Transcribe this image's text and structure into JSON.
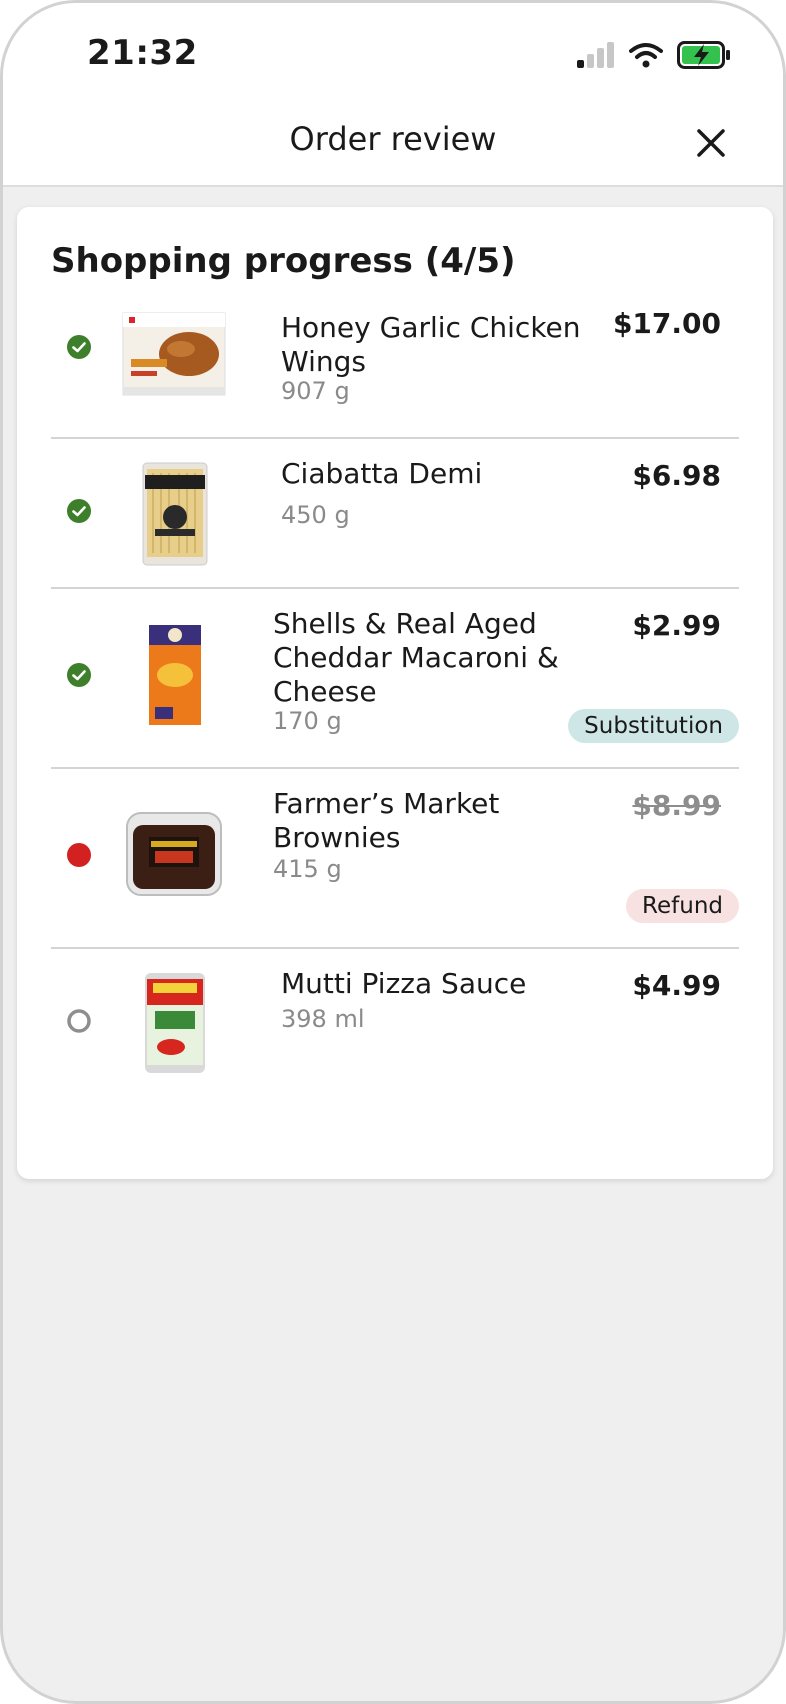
{
  "status_bar": {
    "time": "21:32"
  },
  "header": {
    "title": "Order review"
  },
  "progress": {
    "title": "Shopping progress (4/5)",
    "items": [
      {
        "name_lines": [
          "Honey Garlic Chicken",
          "Wings"
        ],
        "qty": "907 g",
        "price": "$17.00",
        "state": "done",
        "thumb": "chicken-wings-box"
      },
      {
        "name_lines": [
          "Ciabatta Demi"
        ],
        "qty": "450 g",
        "price": "$6.98",
        "state": "done",
        "thumb": "ciabatta-bag"
      },
      {
        "name_lines": [
          "Shells & Real Aged",
          "Cheddar Macaroni &",
          "Cheese"
        ],
        "qty": "170 g",
        "price": "$2.99",
        "state": "done",
        "badge": "Substitution",
        "thumb": "mac-cheese-box"
      },
      {
        "name_lines": [
          "Farmer’s Market",
          "Brownies"
        ],
        "qty": "415 g",
        "price": "$8.99",
        "state": "refunded",
        "badge": "Refund",
        "thumb": "brownie-tub"
      },
      {
        "name_lines": [
          "Mutti Pizza Sauce"
        ],
        "qty": "398 ml",
        "price": "$4.99",
        "state": "pending",
        "thumb": "pizza-sauce-can"
      }
    ]
  },
  "colors": {
    "done": "#3d7f2b",
    "refunded": "#d32020",
    "pending": "#8e8e8e",
    "substitution_badge": "#cfe6e6",
    "refund_badge": "#f8e1e1"
  }
}
